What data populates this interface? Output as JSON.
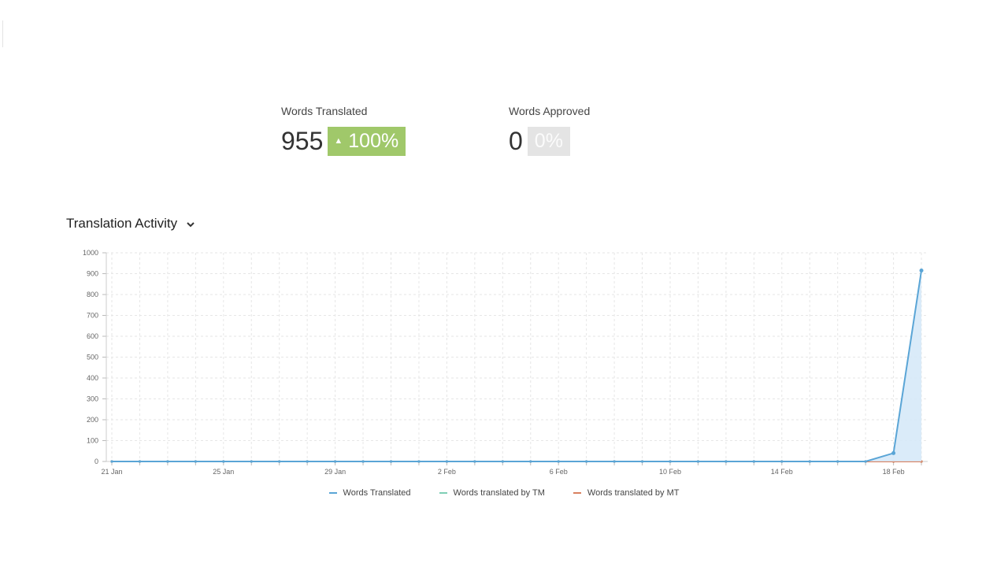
{
  "stats": {
    "translated": {
      "label": "Words Translated",
      "value": "955",
      "change": "100%",
      "arrow": "▲"
    },
    "approved": {
      "label": "Words Approved",
      "value": "0",
      "change": "0%"
    }
  },
  "section": {
    "title": "Translation Activity"
  },
  "colors": {
    "translated": "#5aa5d6",
    "tm": "#7fcfb6",
    "mt": "#d9805f",
    "area": "#d6e9f8",
    "up_badge": "#a0c86a"
  },
  "chart_data": {
    "type": "line",
    "title": "",
    "xlabel": "",
    "ylabel": "",
    "ylim": [
      0,
      1000
    ],
    "yticks": [
      0,
      100,
      200,
      300,
      400,
      500,
      600,
      700,
      800,
      900,
      1000
    ],
    "x": [
      "21 Jan",
      "22 Jan",
      "23 Jan",
      "24 Jan",
      "25 Jan",
      "26 Jan",
      "27 Jan",
      "28 Jan",
      "29 Jan",
      "30 Jan",
      "31 Jan",
      "1 Feb",
      "2 Feb",
      "3 Feb",
      "4 Feb",
      "5 Feb",
      "6 Feb",
      "7 Feb",
      "8 Feb",
      "9 Feb",
      "10 Feb",
      "11 Feb",
      "12 Feb",
      "13 Feb",
      "14 Feb",
      "15 Feb",
      "16 Feb",
      "17 Feb",
      "18 Feb",
      "19 Feb"
    ],
    "xtick_labels": [
      "21 Jan",
      "25 Jan",
      "29 Jan",
      "2 Feb",
      "6 Feb",
      "10 Feb",
      "14 Feb",
      "18 Feb"
    ],
    "grid": true,
    "legend": "bottom",
    "series": [
      {
        "name": "Words translated by TM",
        "values": [
          0,
          0,
          0,
          0,
          0,
          0,
          0,
          0,
          0,
          0,
          0,
          0,
          0,
          0,
          0,
          0,
          0,
          0,
          0,
          0,
          0,
          0,
          0,
          0,
          0,
          0,
          0,
          0,
          0,
          0
        ]
      },
      {
        "name": "Words translated by MT",
        "values": [
          0,
          0,
          0,
          0,
          0,
          0,
          0,
          0,
          0,
          0,
          0,
          0,
          0,
          0,
          0,
          0,
          0,
          0,
          0,
          0,
          0,
          0,
          0,
          0,
          0,
          0,
          0,
          0,
          0,
          0
        ]
      },
      {
        "name": "Words Translated",
        "values": [
          0,
          0,
          0,
          0,
          0,
          0,
          0,
          0,
          0,
          0,
          0,
          0,
          0,
          0,
          0,
          0,
          0,
          0,
          0,
          0,
          0,
          0,
          0,
          0,
          0,
          0,
          0,
          0,
          40,
          915
        ]
      }
    ]
  },
  "legend": {
    "translated": "Words Translated",
    "tm": "Words translated by TM",
    "mt": "Words translated by MT"
  }
}
